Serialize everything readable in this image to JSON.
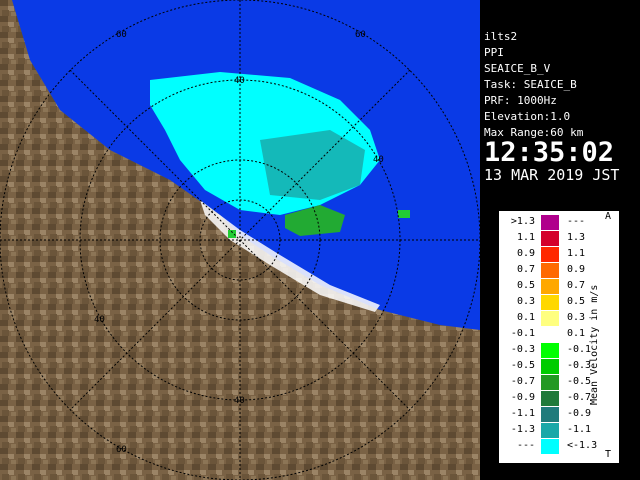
{
  "info": {
    "lines": [
      "ilts2",
      "PPI",
      "SEAICE_B_V",
      "Task: SEAICE_B",
      "PRF: 1000Hz",
      "Elevation:1.0",
      "Max Range:60 km"
    ],
    "time": "12:35:02",
    "date": "13 MAR 2019 JST"
  },
  "legend": {
    "title": "Mean Velocity in m/s",
    "top_mark": "A",
    "bottom_mark": "T",
    "rows": [
      {
        "left": ">1.3",
        "right": "---",
        "color": "#b0008c"
      },
      {
        "left": "1.1",
        "right": "1.3",
        "color": "#d4002a"
      },
      {
        "left": "0.9",
        "right": "1.1",
        "color": "#ff2800"
      },
      {
        "left": "0.7",
        "right": "0.9",
        "color": "#ff6a00"
      },
      {
        "left": "0.5",
        "right": "0.7",
        "color": "#ffa800"
      },
      {
        "left": "0.3",
        "right": "0.5",
        "color": "#ffd800"
      },
      {
        "left": "0.1",
        "right": "0.3",
        "color": "#ffff80"
      },
      {
        "left": "-0.1",
        "right": "0.1",
        "color": "#ffffff"
      },
      {
        "left": "-0.3",
        "right": "-0.1",
        "color": "#00ff00"
      },
      {
        "left": "-0.5",
        "right": "-0.3",
        "color": "#00cc00"
      },
      {
        "left": "-0.7",
        "right": "-0.5",
        "color": "#229922"
      },
      {
        "left": "-0.9",
        "right": "-0.7",
        "color": "#1f7a3a"
      },
      {
        "left": "-1.1",
        "right": "-0.9",
        "color": "#1f7b7b"
      },
      {
        "left": "-1.3",
        "right": "-1.1",
        "color": "#19a8a8"
      },
      {
        "left": "---",
        "right": "<-1.3",
        "color": "#00ffff"
      }
    ]
  },
  "map": {
    "range_labels": [
      "60",
      "40",
      "40",
      "40",
      "40",
      "60",
      "60"
    ]
  }
}
